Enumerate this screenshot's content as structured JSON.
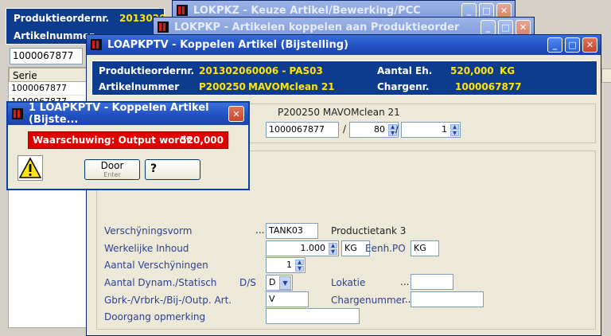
{
  "bg_window": {
    "labels": {
      "order": "Produktieordernr.",
      "article": "Artikelnummer"
    },
    "order_partial": "2013020",
    "search_value": "1000067877",
    "grid": {
      "header": "Serie",
      "rows": [
        "1000067877",
        "1000067877"
      ]
    }
  },
  "win_lokpkz": {
    "title": "LOKPKZ - Keuze Artikel/Bewerking/PCC"
  },
  "win_lokpkp": {
    "title": "LOKPKP - Artikelen koppelen aan Produktieorder"
  },
  "win_main": {
    "title": "LOAPKPTV - Koppelen Artikel (Bijstelling)",
    "header": {
      "order_label": "Produktieordernr.",
      "order_value": "201302060006 - PAS03",
      "article_label": "Artikelnummer",
      "article_code": "P200250",
      "article_name": "MAVOMclean 21",
      "qty_label": "Aantal Eh.",
      "qty_value": "520,000",
      "qty_unit": "KG",
      "charge_label": "Chargenr.",
      "charge_value": "1000067877"
    },
    "top_article": "P200250  MAVOMclean 21",
    "key_fields": {
      "code": "1000067877",
      "sep1": "/",
      "num1": "80",
      "sep2": "/",
      "num2": "1"
    },
    "form": {
      "verschijningsvorm": {
        "label": "Verschÿningsvorm",
        "dots": "...",
        "value": "TANK03",
        "desc": "Productietank 3"
      },
      "inhoud": {
        "label": "Werkelijke Inhoud",
        "value": "1.000",
        "unit": "KG",
        "unit_label": "Eenh.PO",
        "unit_po": "KG"
      },
      "aantal": {
        "label": "Aantal Verschÿningen",
        "value": "1"
      },
      "dynam": {
        "label": "Aantal Dynam./Statisch",
        "ds_label": "D/S",
        "value": "D",
        "lokatie_label": "Lokatie",
        "lokatie_dots": "...",
        "lokatie_value": ""
      },
      "gbrk": {
        "label": "Gbrk-/Vrbrk-/Bij-/Outp. Art.",
        "value": "V",
        "charge_label": "Chargenummer",
        "charge_dots": "...",
        "charge_value": ""
      },
      "opmerking": {
        "label": "Doorgang opmerking",
        "value": ""
      }
    }
  },
  "win_warning": {
    "title": "1 LOAPKPTV - Koppelen Artikel (Bijste...",
    "message": "Waarschuwing: Output wordt",
    "amount": "520,000",
    "door_label": "Door",
    "door_sub": "Enter",
    "help_icon": "question-icon",
    "warn_icon": "warning-icon"
  },
  "colors": {
    "title_blue": "#1f4fbf",
    "info_bar": "#0d3c8f",
    "value_yellow": "#ffe600",
    "warning_red": "#e00000"
  }
}
